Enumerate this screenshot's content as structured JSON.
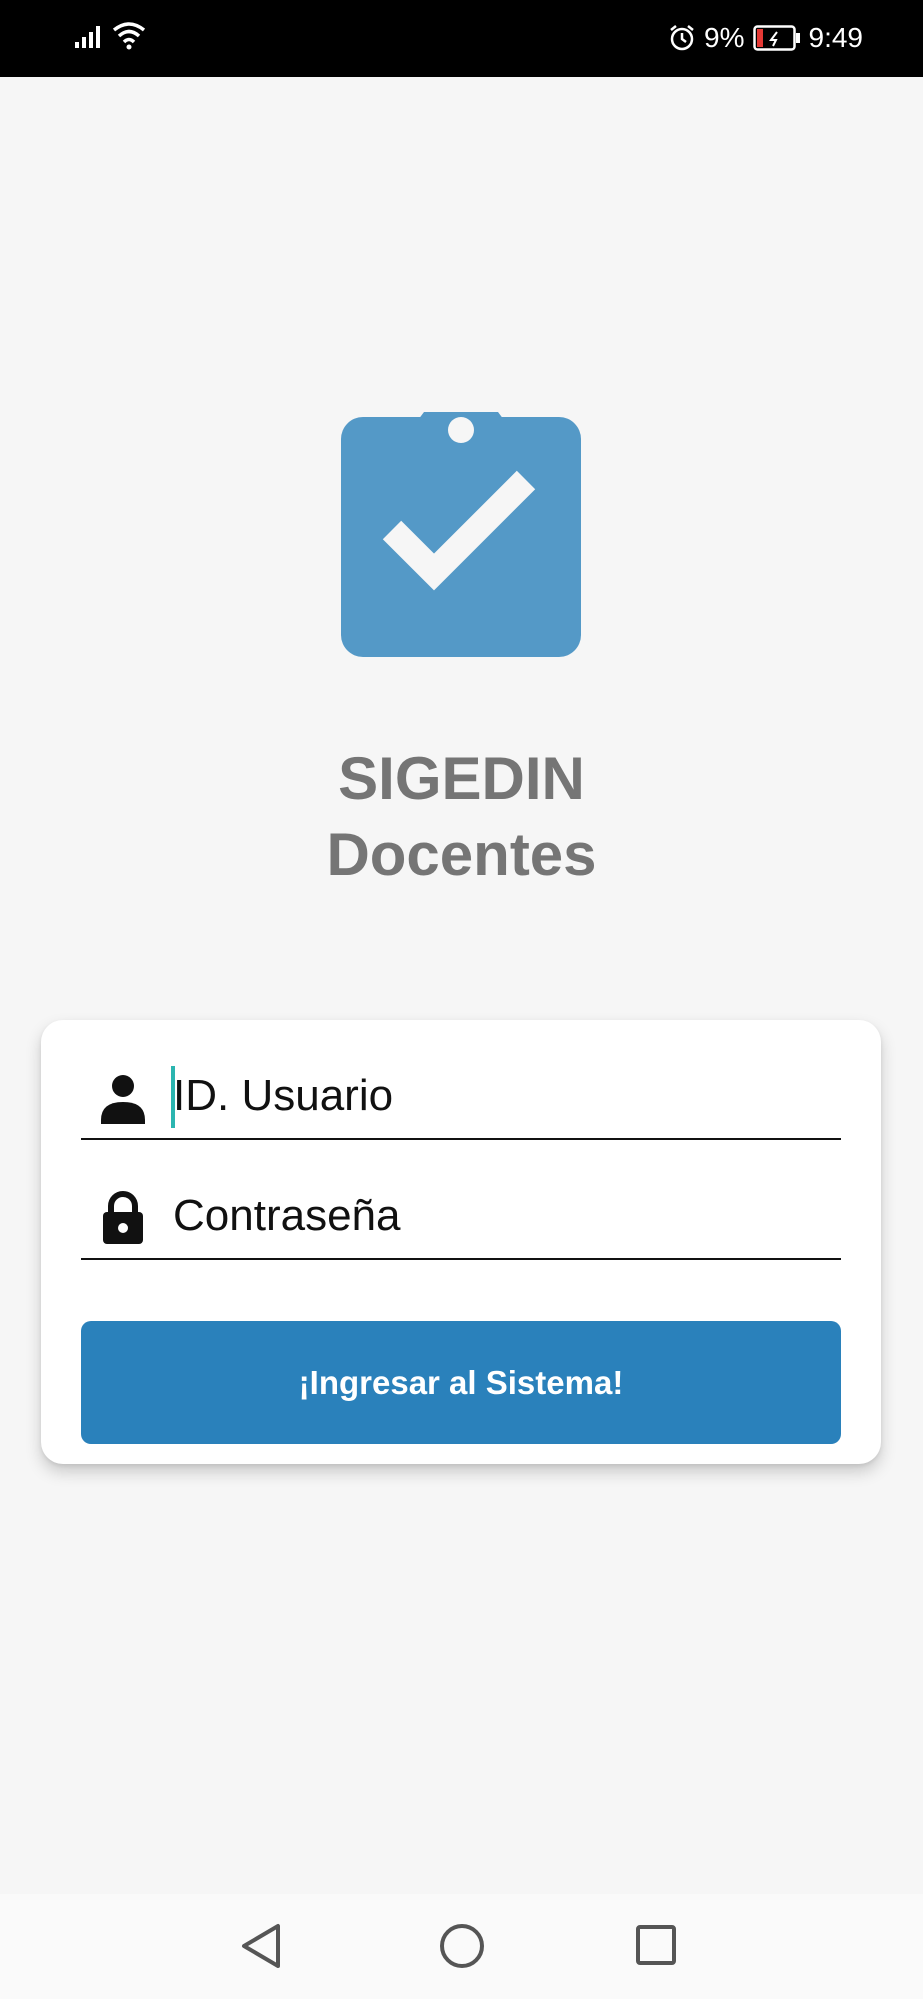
{
  "status_bar": {
    "battery_percent": "9%",
    "time": "9:49",
    "icons": [
      "signal-icon",
      "wifi-icon",
      "alarm-icon",
      "battery-icon"
    ]
  },
  "app": {
    "title_line1": "SIGEDIN",
    "title_line2": "Docentes",
    "logo_icon": "clipboard-check-icon",
    "accent_color": "#5499c7",
    "button_color": "#2a81bb"
  },
  "login_form": {
    "user_field": {
      "placeholder": "ID. Usuario",
      "icon": "person-icon"
    },
    "password_field": {
      "placeholder": "Contraseña",
      "icon": "lock-icon"
    },
    "submit_label": "¡Ingresar al Sistema!"
  },
  "nav_bar": {
    "icons": [
      "back-icon",
      "home-icon",
      "recent-apps-icon"
    ]
  }
}
